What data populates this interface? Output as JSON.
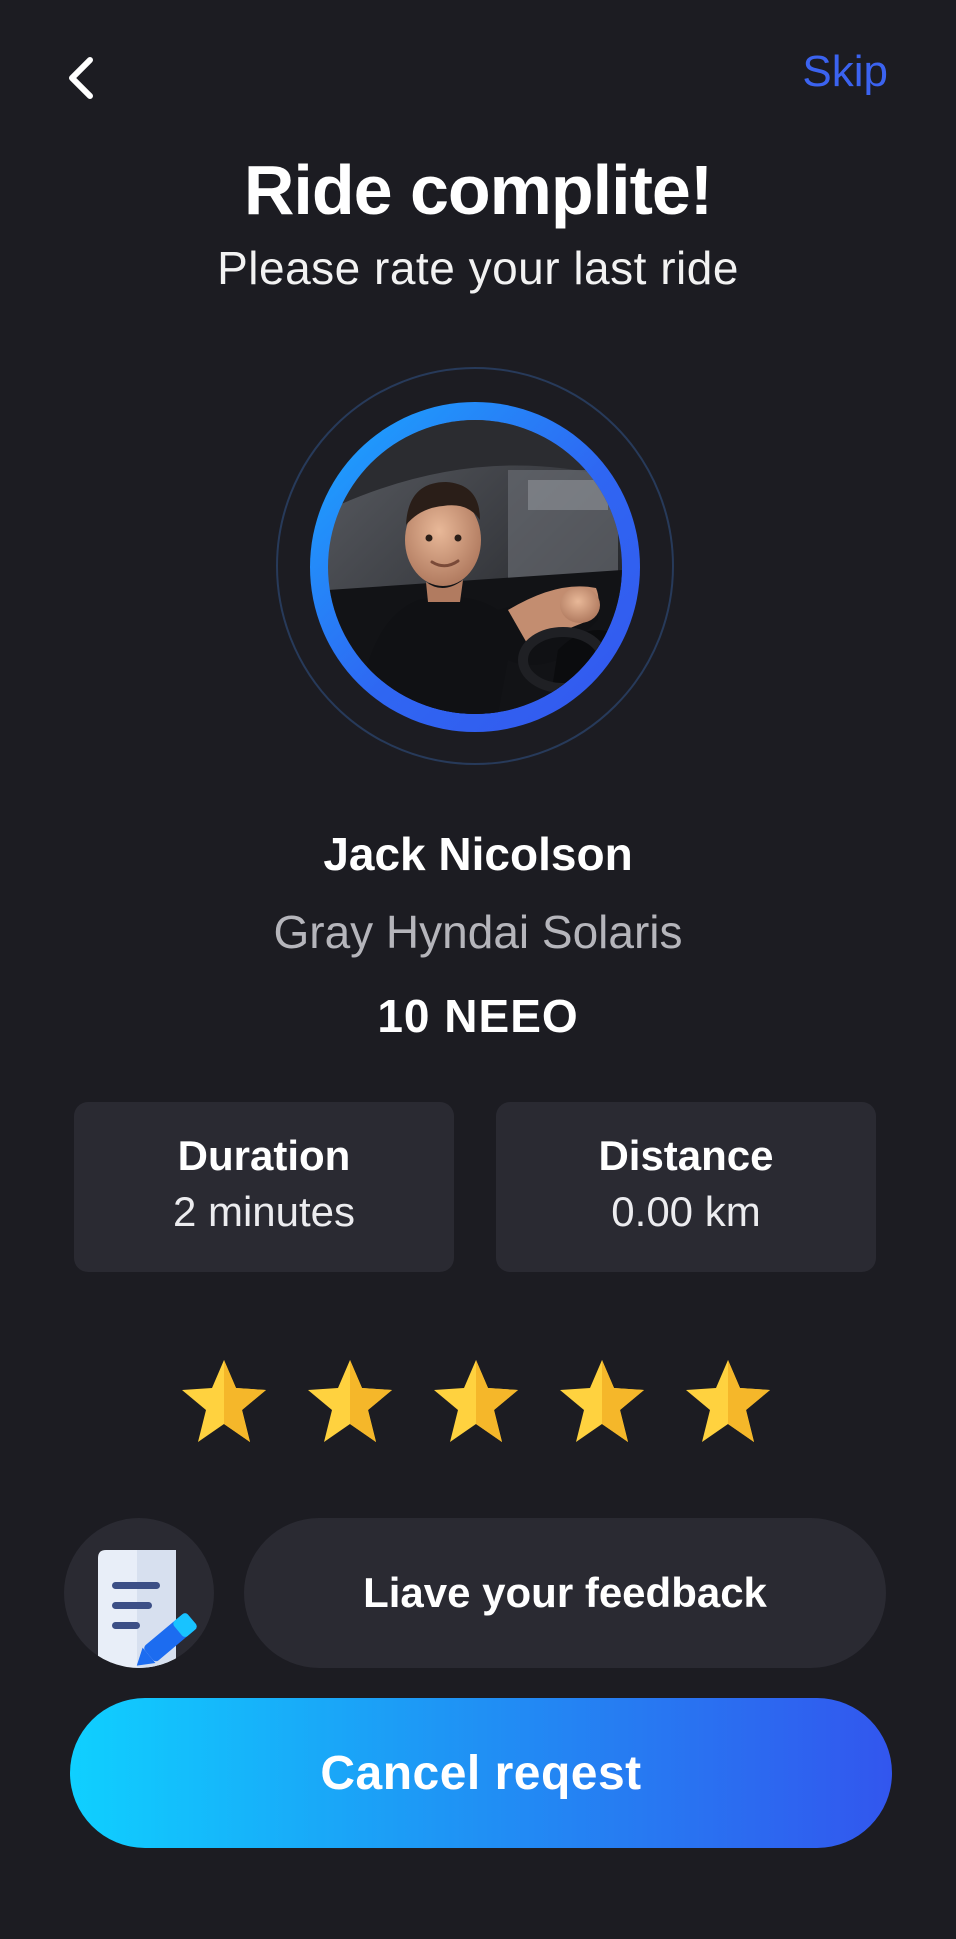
{
  "header": {
    "back_icon": "chevron-left-icon",
    "skip_label": "Skip"
  },
  "title": "Ride complite!",
  "subtitle": "Please rate your last ride",
  "driver": {
    "name": "Jack Nicolson",
    "car": "Gray Hyndai Solaris",
    "plate": "10 NEEO"
  },
  "stats": {
    "duration": {
      "label": "Duration",
      "value": "2 minutes"
    },
    "distance": {
      "label": "Distance",
      "value": "0.00 km"
    }
  },
  "rating": {
    "stars_selected": 5,
    "stars_total": 5,
    "star_color": "#ffc93c"
  },
  "feedback": {
    "icon": "note-pencil-icon",
    "label": "Liave your feedback"
  },
  "cancel_label": "Cancel reqest",
  "colors": {
    "background": "#1c1c22",
    "card": "#2a2a32",
    "accent": "#3b63f0",
    "gradient_start": "#0fd0ff",
    "gradient_end": "#3256ee"
  }
}
